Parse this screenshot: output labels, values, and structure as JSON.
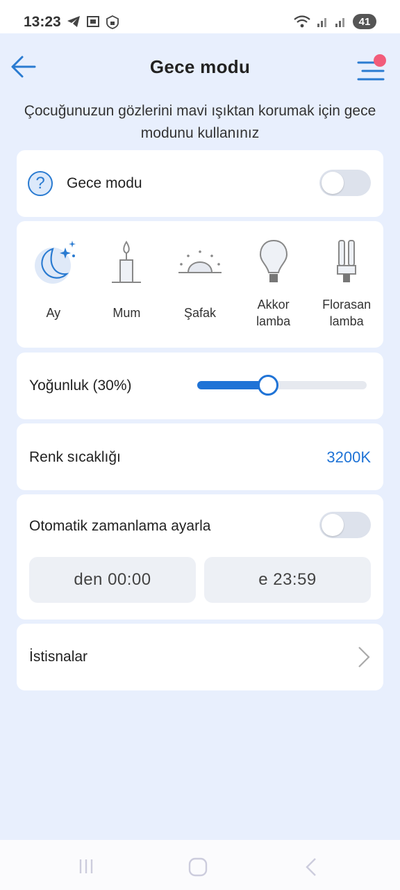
{
  "status": {
    "time": "13:23",
    "battery": "41"
  },
  "header": {
    "title": "Gece modu"
  },
  "subtitle": "Çocuğunuzun gözlerini mavi ışıktan korumak için gece modunu kullanınız",
  "night_mode": {
    "label": "Gece modu",
    "enabled": false
  },
  "modes": [
    {
      "label": "Ay",
      "icon": "moon-stars-icon"
    },
    {
      "label": "Mum",
      "icon": "candle-icon"
    },
    {
      "label": "Şafak",
      "icon": "dawn-icon"
    },
    {
      "label": "Akkor lamba",
      "icon": "bulb-icon"
    },
    {
      "label": "Florasan lamba",
      "icon": "fluorescent-lamp-icon"
    }
  ],
  "intensity": {
    "label": "Yoğunluk (30%)",
    "value_fraction": 0.42
  },
  "color_temp": {
    "label": "Renk sıcaklığı",
    "value": "3200K"
  },
  "schedule": {
    "label": "Otomatik zamanlama ayarla",
    "enabled": false,
    "from": "den  00:00",
    "to": "e  23:59"
  },
  "exceptions": {
    "label": "İstisnalar"
  },
  "colors": {
    "accent": "#1f73d6",
    "background": "#e8effd",
    "badge": "#f25c7a"
  }
}
